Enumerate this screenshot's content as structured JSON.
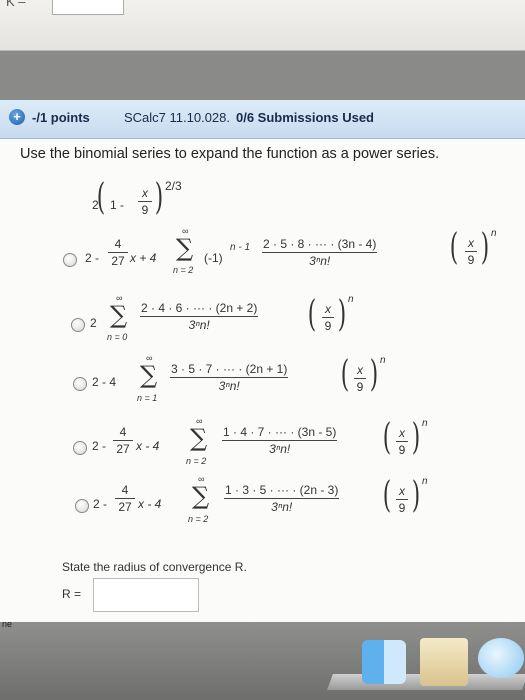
{
  "top_strip": {
    "stub_text": "K –"
  },
  "header": {
    "points": "-/1 points",
    "code": "SCalc7 11.10.028.",
    "submissions": "0/6 Submissions Used"
  },
  "question": {
    "prompt": "Use the binomial series to expand the function as a power series.",
    "function": {
      "coef": "2",
      "one": "1 -",
      "num": "x",
      "den": "9",
      "exp": "2/3"
    }
  },
  "options": [
    {
      "prefix": "2 -",
      "f_num": "4",
      "f_den": "27",
      "mid": "x + 4",
      "upper": "∞",
      "lower": "n = 2",
      "term": "(-1)",
      "term_exp": "n - 1",
      "num": "2 · 5 · 8 · ··· · (3n - 4)",
      "den": "3ⁿn!",
      "x": "x",
      "nine": "9",
      "pow": "n"
    },
    {
      "prefix": "2",
      "upper": "∞",
      "lower": "n = 0",
      "num": "2 · 4 · 6 · ··· · (2n + 2)",
      "den": "3ⁿn!",
      "x": "x",
      "nine": "9",
      "pow": "n"
    },
    {
      "prefix": "2 - 4",
      "upper": "∞",
      "lower": "n = 1",
      "num": "3 · 5 · 7 · ··· · (2n + 1)",
      "den": "3ⁿn!",
      "x": "x",
      "nine": "9",
      "pow": "n"
    },
    {
      "prefix": "2 -",
      "f_num": "4",
      "f_den": "27",
      "mid": "x - 4",
      "upper": "∞",
      "lower": "n = 2",
      "num": "1 · 4 · 7 · ··· · (3n - 5)",
      "den": "3ⁿn!",
      "x": "x",
      "nine": "9",
      "pow": "n"
    },
    {
      "prefix": "2 -",
      "f_num": "4",
      "f_den": "27",
      "mid": "x - 4",
      "upper": "∞",
      "lower": "n = 2",
      "num": "1 · 3 · 5 · ··· · (2n - 3)",
      "den": "3ⁿn!",
      "x": "x",
      "nine": "9",
      "pow": "n"
    }
  ],
  "radius": {
    "prompt": "State the radius of convergence R.",
    "label": "R =",
    "value": ""
  },
  "dock": {
    "stub_text": "ne"
  }
}
